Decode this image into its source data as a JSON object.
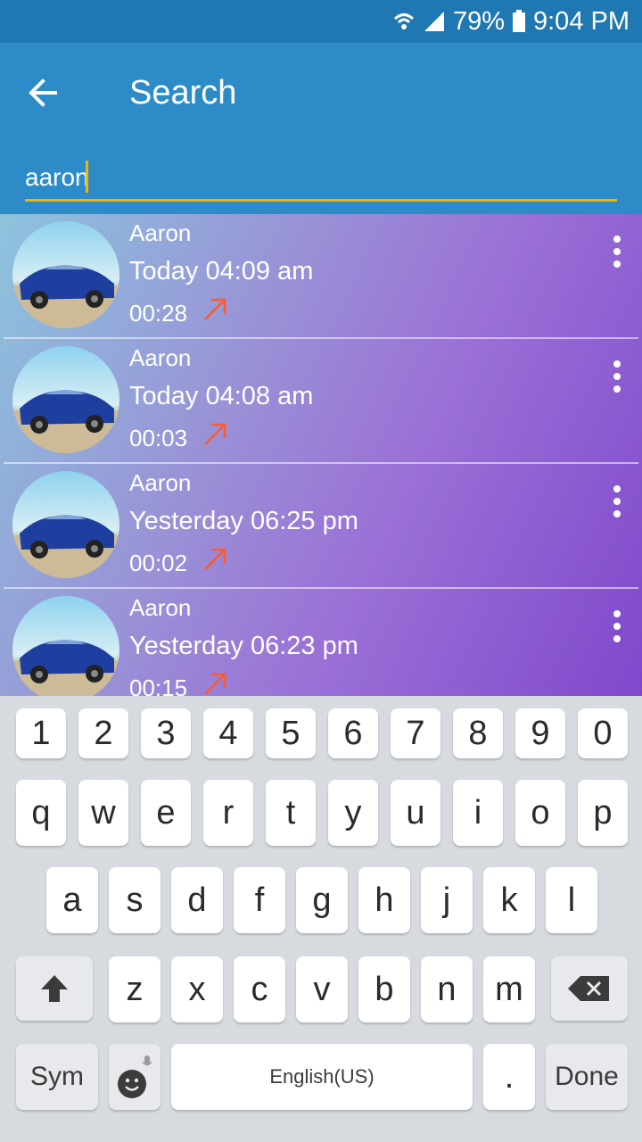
{
  "status_bar": {
    "battery": "79%",
    "time": "9:04 PM"
  },
  "header": {
    "title": "Search",
    "back_icon": "arrow-back-icon"
  },
  "search": {
    "value": "aaron"
  },
  "results": [
    {
      "name": "Aaron",
      "time": "Today 04:09 am",
      "duration": "00:28",
      "call_type": "outgoing-call-icon"
    },
    {
      "name": "Aaron",
      "time": "Today 04:08 am",
      "duration": "00:03",
      "call_type": "outgoing-call-icon"
    },
    {
      "name": "Aaron",
      "time": "Yesterday 06:25 pm",
      "duration": "00:02",
      "call_type": "outgoing-call-icon"
    },
    {
      "name": "Aaron",
      "time": "Yesterday 06:23 pm",
      "duration": "00:15",
      "call_type": "outgoing-call-icon"
    }
  ],
  "keyboard": {
    "row_numbers": [
      "1",
      "2",
      "3",
      "4",
      "5",
      "6",
      "7",
      "8",
      "9",
      "0"
    ],
    "row_top": [
      "q",
      "w",
      "e",
      "r",
      "t",
      "y",
      "u",
      "i",
      "o",
      "p"
    ],
    "row_middle": [
      "a",
      "s",
      "d",
      "f",
      "g",
      "h",
      "j",
      "k",
      "l"
    ],
    "row_bottom": [
      "z",
      "x",
      "c",
      "v",
      "b",
      "n",
      "m"
    ],
    "sym_label": "Sym",
    "space_label": "English(US)",
    "period_label": ".",
    "done_label": "Done"
  },
  "colors": {
    "status_bar": "#1f78b1",
    "app_bar": "#2d8cc8",
    "input_underline": "#f0b600",
    "call_arrow": "#ff5a2c"
  }
}
